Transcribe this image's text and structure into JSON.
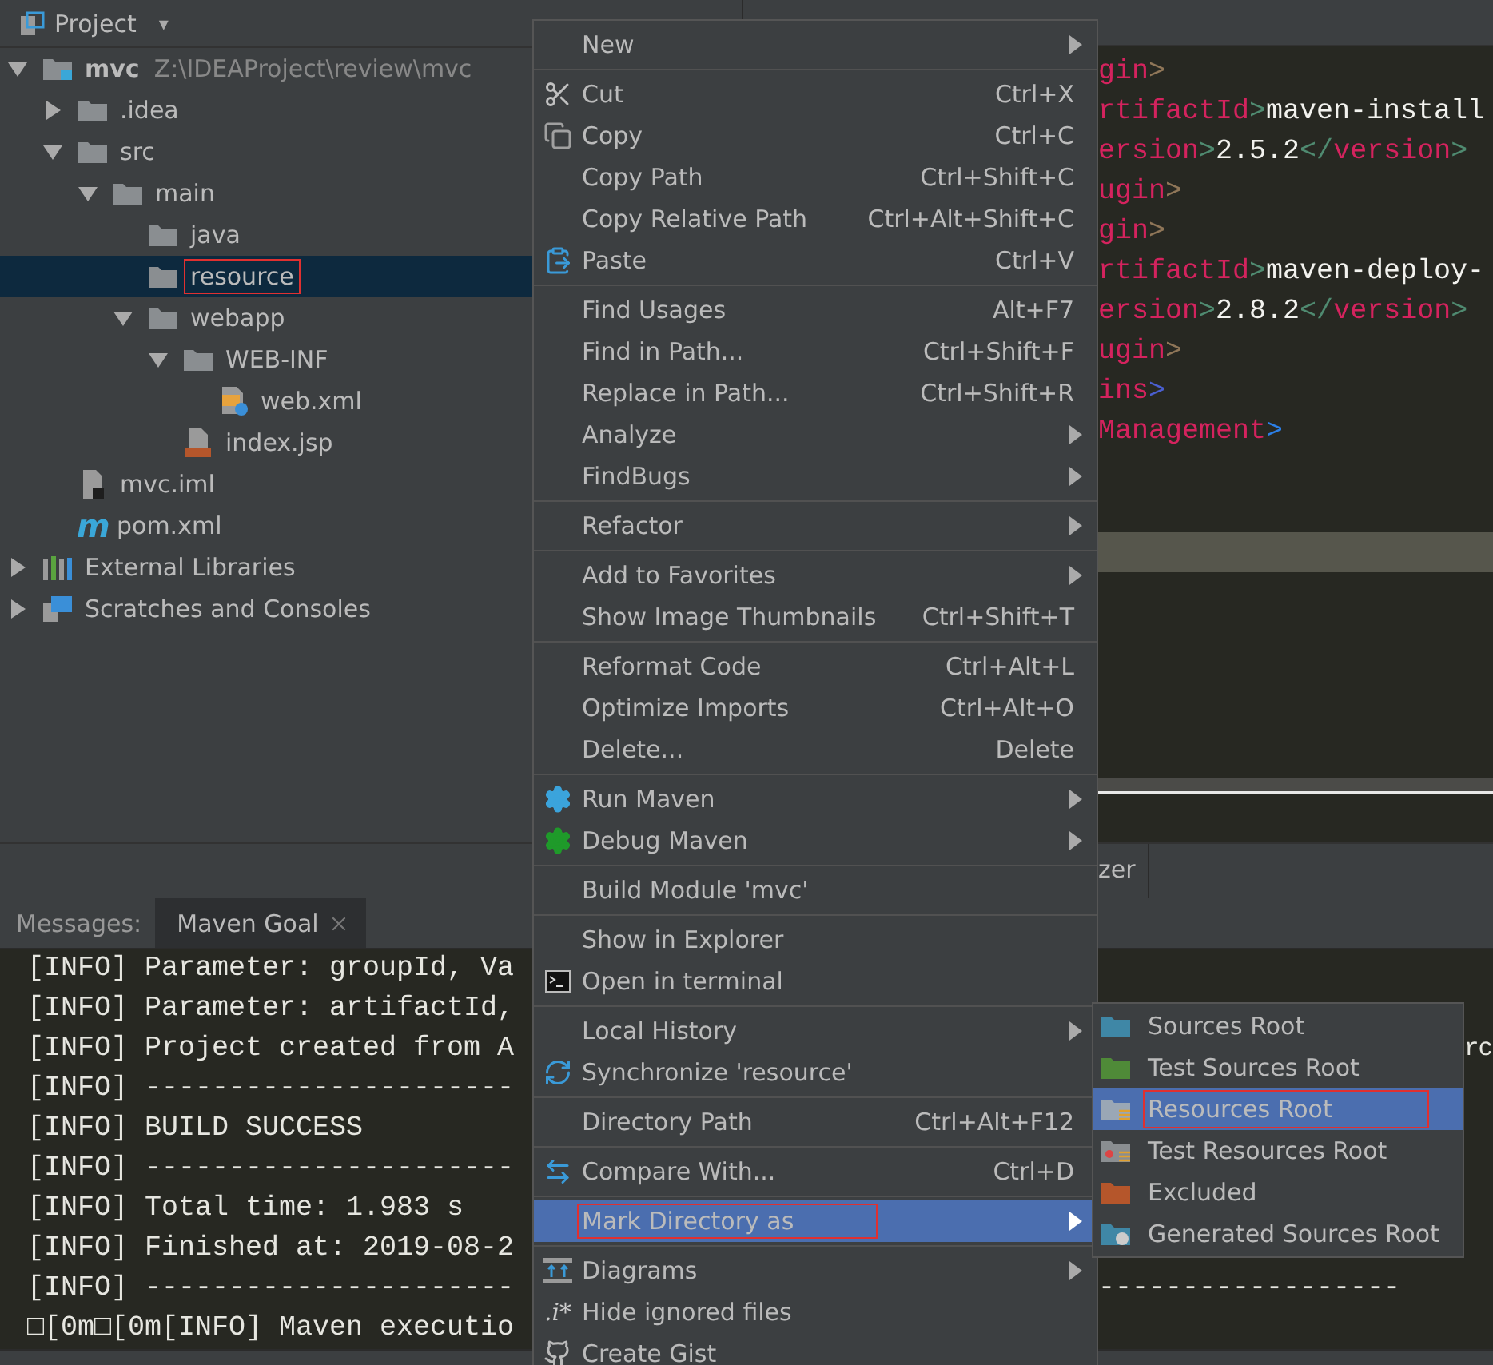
{
  "project_panel": {
    "title": "Project",
    "caret": "▾",
    "tree": [
      {
        "label": "mvc",
        "path": "Z:\\IDEAProject\\review\\mvc",
        "kind": "module",
        "expanded": true,
        "selected": false,
        "outlined": false,
        "children": [
          {
            "label": ".idea",
            "kind": "folder",
            "expanded": false,
            "selected": false,
            "outlined": false
          },
          {
            "label": "src",
            "kind": "folder",
            "expanded": true,
            "selected": false,
            "outlined": false,
            "children": [
              {
                "label": "main",
                "kind": "folder",
                "expanded": true,
                "selected": false,
                "outlined": false,
                "children": [
                  {
                    "label": "java",
                    "kind": "folder",
                    "selected": false,
                    "outlined": false
                  },
                  {
                    "label": "resource",
                    "kind": "folder",
                    "selected": true,
                    "outlined": true
                  },
                  {
                    "label": "webapp",
                    "kind": "folder",
                    "expanded": true,
                    "selected": false,
                    "outlined": false,
                    "children": [
                      {
                        "label": "WEB-INF",
                        "kind": "folder",
                        "expanded": true,
                        "selected": false,
                        "outlined": false,
                        "children": [
                          {
                            "label": "web.xml",
                            "kind": "xml",
                            "selected": false,
                            "outlined": false
                          }
                        ]
                      },
                      {
                        "label": "index.jsp",
                        "kind": "jsp",
                        "selected": false,
                        "outlined": false
                      }
                    ]
                  }
                ]
              }
            ]
          },
          {
            "label": "mvc.iml",
            "kind": "iml",
            "selected": false,
            "outlined": false
          },
          {
            "label": "pom.xml",
            "kind": "maven",
            "glyph": "m",
            "selected": false,
            "outlined": false
          }
        ]
      },
      {
        "label": "External Libraries",
        "kind": "libraries",
        "expanded": false,
        "selected": false,
        "outlined": false
      },
      {
        "label": "Scratches and Consoles",
        "kind": "scratches",
        "expanded": false,
        "selected": false,
        "outlined": false
      }
    ]
  },
  "editor": {
    "lines": [
      {
        "current": false,
        "segments": [
          {
            "t": "gin",
            "kind": "tag"
          },
          {
            "t": ">",
            "kind": "brown"
          }
        ]
      },
      {
        "current": false,
        "segments": [
          {
            "t": "rtifactId",
            "kind": "tag"
          },
          {
            "t": ">",
            "kind": "punct"
          },
          {
            "t": "maven-install",
            "kind": "text"
          }
        ]
      },
      {
        "current": false,
        "segments": [
          {
            "t": "ersion",
            "kind": "tag"
          },
          {
            "t": ">",
            "kind": "punct"
          },
          {
            "t": "2.5.2",
            "kind": "text"
          },
          {
            "t": "</",
            "kind": "punct"
          },
          {
            "t": "version",
            "kind": "tag"
          },
          {
            "t": ">",
            "kind": "punct"
          }
        ]
      },
      {
        "current": false,
        "segments": [
          {
            "t": "ugin",
            "kind": "tag"
          },
          {
            "t": ">",
            "kind": "brown"
          }
        ]
      },
      {
        "current": false,
        "segments": [
          {
            "t": "gin",
            "kind": "tag"
          },
          {
            "t": ">",
            "kind": "brown"
          }
        ]
      },
      {
        "current": false,
        "segments": [
          {
            "t": "rtifactId",
            "kind": "tag"
          },
          {
            "t": ">",
            "kind": "punct"
          },
          {
            "t": "maven-deploy-",
            "kind": "text"
          }
        ]
      },
      {
        "current": false,
        "segments": [
          {
            "t": "ersion",
            "kind": "tag"
          },
          {
            "t": ">",
            "kind": "punct"
          },
          {
            "t": "2.8.2",
            "kind": "text"
          },
          {
            "t": "</",
            "kind": "punct"
          },
          {
            "t": "version",
            "kind": "tag"
          },
          {
            "t": ">",
            "kind": "punct"
          }
        ]
      },
      {
        "current": false,
        "segments": [
          {
            "t": "ugin",
            "kind": "tag"
          },
          {
            "t": ">",
            "kind": "brown"
          }
        ]
      },
      {
        "current": false,
        "segments": [
          {
            "t": "ins",
            "kind": "tag"
          },
          {
            "t": ">",
            "kind": "navy"
          }
        ]
      },
      {
        "current": false,
        "segments": [
          {
            "t": "Management",
            "kind": "tag"
          },
          {
            "t": ">",
            "kind": "blue"
          }
        ]
      },
      {
        "current": false
      },
      {
        "current": false
      },
      {
        "current": true
      }
    ]
  },
  "tool_strip": {
    "tab_fragment": "zer"
  },
  "messages": {
    "label": "Messages:",
    "tabs": [
      {
        "label": "Maven Goal",
        "selected": true
      }
    ],
    "lines": [
      {
        "text": "[INFO] Parameter: groupId, Va"
      },
      {
        "text": "[INFO] Parameter: artifactId,"
      },
      {
        "text": "[INFO] Project created from A",
        "tail": "rc"
      },
      {
        "text": "[INFO] ----------------------"
      },
      {
        "text": "[INFO] BUILD SUCCESS"
      },
      {
        "text": "[INFO] ----------------------"
      },
      {
        "text": "[INFO] Total time: 1.983 s"
      },
      {
        "text": "[INFO] Finished at: 2019-08-2"
      },
      {
        "text": "[INFO] ----------------------",
        "tail": "------------------"
      },
      {
        "text": "□[0m□[0m[INFO] Maven executio"
      }
    ]
  },
  "context_menu": {
    "items": [
      {
        "kind": "item",
        "label": "New",
        "submenu": true,
        "selected": false,
        "outlined": false
      },
      {
        "kind": "separator"
      },
      {
        "kind": "scissors",
        "label": "Cut",
        "shortcut": "Ctrl+X",
        "selected": false,
        "outlined": false
      },
      {
        "kind": "copy",
        "label": "Copy",
        "shortcut": "Ctrl+C",
        "selected": false,
        "outlined": false
      },
      {
        "kind": "item",
        "label": "Copy Path",
        "shortcut": "Ctrl+Shift+C",
        "selected": false,
        "outlined": false
      },
      {
        "kind": "item",
        "label": "Copy Relative Path",
        "shortcut": "Ctrl+Alt+Shift+C",
        "selected": false,
        "outlined": false
      },
      {
        "kind": "paste",
        "label": "Paste",
        "shortcut": "Ctrl+V",
        "selected": false,
        "outlined": false
      },
      {
        "kind": "separator"
      },
      {
        "kind": "item",
        "label": "Find Usages",
        "shortcut": "Alt+F7",
        "selected": false,
        "outlined": false
      },
      {
        "kind": "item",
        "label": "Find in Path...",
        "shortcut": "Ctrl+Shift+F",
        "selected": false,
        "outlined": false
      },
      {
        "kind": "item",
        "label": "Replace in Path...",
        "shortcut": "Ctrl+Shift+R",
        "selected": false,
        "outlined": false
      },
      {
        "kind": "item",
        "label": "Analyze",
        "submenu": true,
        "selected": false,
        "outlined": false
      },
      {
        "kind": "item",
        "label": "FindBugs",
        "submenu": true,
        "selected": false,
        "outlined": false
      },
      {
        "kind": "separator"
      },
      {
        "kind": "item",
        "label": "Refactor",
        "submenu": true,
        "selected": false,
        "outlined": false
      },
      {
        "kind": "separator"
      },
      {
        "kind": "item",
        "label": "Add to Favorites",
        "submenu": true,
        "selected": false,
        "outlined": false
      },
      {
        "kind": "item",
        "label": "Show Image Thumbnails",
        "shortcut": "Ctrl+Shift+T",
        "selected": false,
        "outlined": false
      },
      {
        "kind": "separator"
      },
      {
        "kind": "item",
        "label": "Reformat Code",
        "shortcut": "Ctrl+Alt+L",
        "selected": false,
        "outlined": false
      },
      {
        "kind": "item",
        "label": "Optimize Imports",
        "shortcut": "Ctrl+Alt+O",
        "selected": false,
        "outlined": false
      },
      {
        "kind": "item",
        "label": "Delete...",
        "shortcut": "Delete",
        "selected": false,
        "outlined": false
      },
      {
        "kind": "separator"
      },
      {
        "kind": "run_gear",
        "label": "Run Maven",
        "submenu": true,
        "selected": false,
        "outlined": false
      },
      {
        "kind": "debug_gear",
        "label": "Debug Maven",
        "submenu": true,
        "selected": false,
        "outlined": false
      },
      {
        "kind": "separator"
      },
      {
        "kind": "item",
        "label": "Build Module 'mvc'",
        "selected": false,
        "outlined": false
      },
      {
        "kind": "separator"
      },
      {
        "kind": "item",
        "label": "Show in Explorer",
        "selected": false,
        "outlined": false
      },
      {
        "kind": "terminal",
        "label": "Open in terminal",
        "selected": false,
        "outlined": false
      },
      {
        "kind": "separator"
      },
      {
        "kind": "item",
        "label": "Local History",
        "submenu": true,
        "selected": false,
        "outlined": false
      },
      {
        "kind": "sync",
        "label": "Synchronize 'resource'",
        "selected": false,
        "outlined": false
      },
      {
        "kind": "separator"
      },
      {
        "kind": "item",
        "label": "Directory Path",
        "shortcut": "Ctrl+Alt+F12",
        "selected": false,
        "outlined": false
      },
      {
        "kind": "separator"
      },
      {
        "kind": "compare",
        "label": "Compare With...",
        "shortcut": "Ctrl+D",
        "selected": false,
        "outlined": false
      },
      {
        "kind": "separator"
      },
      {
        "kind": "item",
        "label": "Mark Directory as",
        "submenu": true,
        "selected": true,
        "outlined": true
      },
      {
        "kind": "separator"
      },
      {
        "kind": "diagram",
        "label": "Diagrams",
        "submenu": true,
        "selected": false,
        "outlined": false
      },
      {
        "kind": "item",
        "label": "Hide ignored files",
        "glyph": ".i*",
        "selected": false,
        "outlined": false
      },
      {
        "kind": "gist",
        "label": "Create Gist",
        "selected": false,
        "outlined": false
      }
    ]
  },
  "submenu": {
    "items": [
      {
        "label": "Sources Root",
        "kind": "sources",
        "selected": false,
        "outlined": false
      },
      {
        "label": "Test Sources Root",
        "kind": "test_sources",
        "selected": false,
        "outlined": false
      },
      {
        "label": "Resources Root",
        "kind": "resources",
        "selected": true,
        "outlined": true
      },
      {
        "label": "Test Resources Root",
        "kind": "test_resources",
        "selected": false,
        "outlined": false
      },
      {
        "label": "Excluded",
        "kind": "excluded",
        "selected": false,
        "outlined": false
      },
      {
        "label": "Generated Sources Root",
        "kind": "generated",
        "selected": false,
        "outlined": false
      }
    ]
  }
}
